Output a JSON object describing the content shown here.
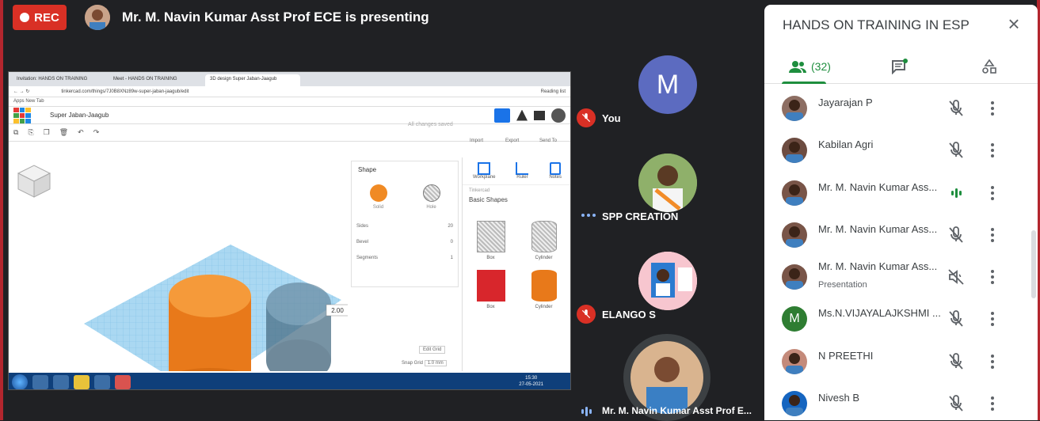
{
  "top_bar": {
    "rec_label": "REC",
    "presenter_text": "Mr. M. Navin Kumar Asst Prof ECE is presenting"
  },
  "shared_screen": {
    "tabs": [
      "Invitation: HANDS ON TRAINING",
      "Meet - HANDS ON TRAINING",
      "3D design Super Jaban-Jaagub"
    ],
    "url": "tinkercad.com/things/7J0B8XNz89w-super-jaban-jaagub/edit",
    "bookmarks": "Apps   New Tab",
    "reading_list": "Reading list",
    "design_name": "Super Jaban-Jaagub",
    "saved_status": "All changes saved",
    "actions": [
      "Import",
      "Export",
      "Send To"
    ],
    "shape_panel": {
      "title": "Shape",
      "solid": "Solid",
      "hole": "Hole",
      "params": [
        {
          "label": "Sides",
          "value": "20"
        },
        {
          "label": "Bevel",
          "value": "0"
        },
        {
          "label": "Segments",
          "value": "1"
        }
      ]
    },
    "dimension_label": "2.00",
    "right_tools": [
      "Workplane",
      "Ruler",
      "Notes"
    ],
    "library_source": "Tinkercad",
    "library_name": "Basic Shapes",
    "shapes": [
      "Box",
      "Cylinder",
      "Box",
      "Cylinder"
    ],
    "edit_grid": "Edit Grid",
    "snap_grid_label": "Snap Grid",
    "snap_grid_value": "1.0 mm",
    "clock_time": "15:30",
    "clock_date": "27-05-2021"
  },
  "participants_grid": [
    {
      "name": "You",
      "avatar_letter": "M",
      "avatar_color": "#5c6bc0",
      "muted": true
    },
    {
      "name": "SPP CREATION",
      "muted": false
    },
    {
      "name": "ELANGO S",
      "muted": true
    },
    {
      "name": "Mr. M. Navin Kumar Asst Prof E...",
      "muted": false
    }
  ],
  "side_panel": {
    "title": "HANDS ON TRAINING IN ESP",
    "people_count": "(32)",
    "people": [
      {
        "name": "Jayarajan P",
        "sub": "",
        "avatar_color": "#8d6e63",
        "letter": "",
        "mic": "off"
      },
      {
        "name": "Kabilan Agri",
        "sub": "",
        "avatar_color": "#6d4c41",
        "letter": "",
        "mic": "off"
      },
      {
        "name": "Mr. M. Navin Kumar Ass...",
        "sub": "",
        "avatar_color": "#795548",
        "letter": "",
        "mic": "speaking"
      },
      {
        "name": "Mr. M. Navin Kumar Ass...",
        "sub": "",
        "avatar_color": "#795548",
        "letter": "",
        "mic": "off"
      },
      {
        "name": "Mr. M. Navin Kumar Ass...",
        "sub": "Presentation",
        "avatar_color": "#795548",
        "letter": "",
        "mic": "volume-off"
      },
      {
        "name": "Ms.N.VIJAYALAJKSHMI ...",
        "sub": "",
        "avatar_color": "#2e7d32",
        "letter": "M",
        "mic": "off"
      },
      {
        "name": "N PREETHI",
        "sub": "",
        "avatar_color": "#c48a7a",
        "letter": "",
        "mic": "off"
      },
      {
        "name": "Nivesh B",
        "sub": "",
        "avatar_color": "#1565c0",
        "letter": "",
        "mic": "off"
      }
    ]
  },
  "colors": {
    "accent_green": "#1e8e3e",
    "rec_red": "#d93025",
    "orange_shape": "#f08a24"
  }
}
